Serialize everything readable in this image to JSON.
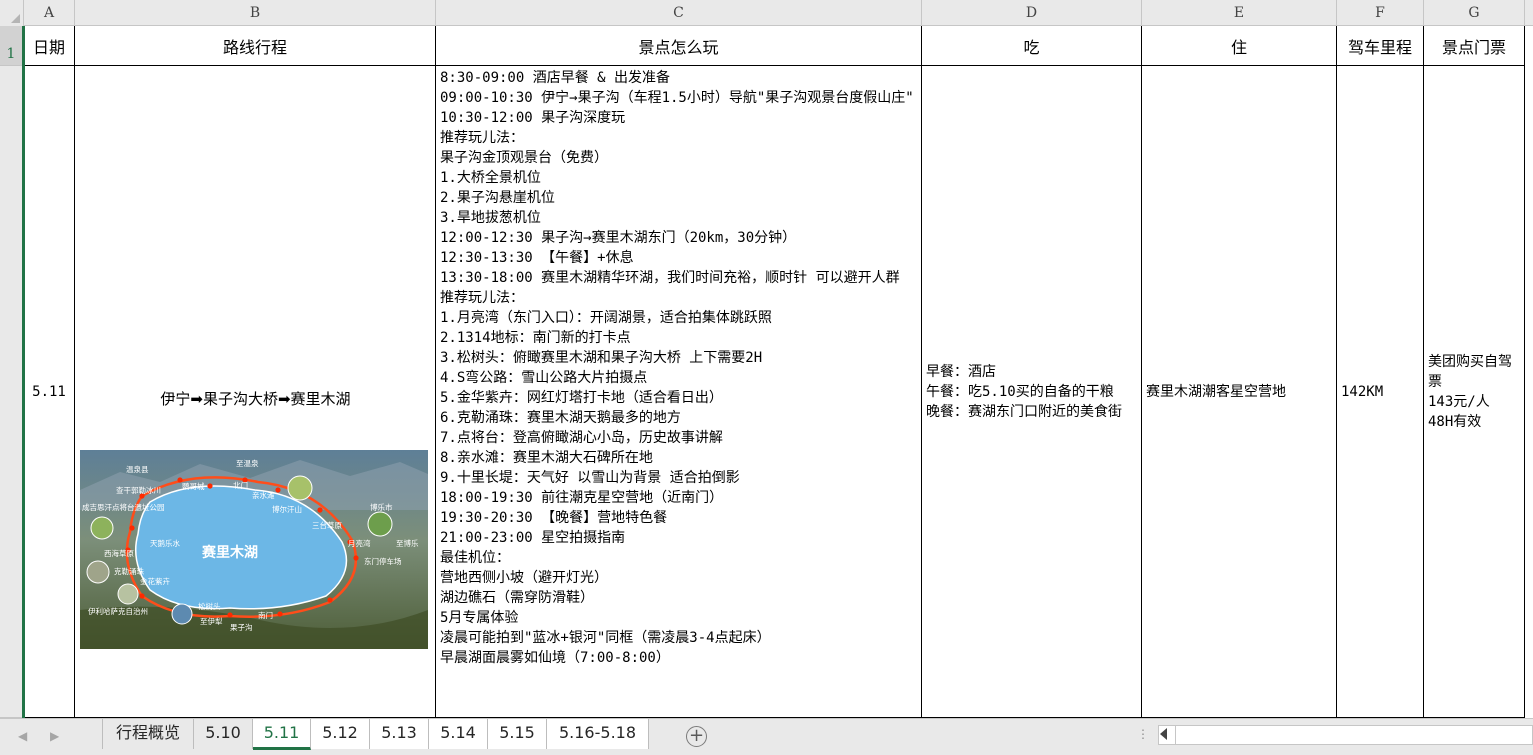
{
  "columns": [
    {
      "letter": "A"
    },
    {
      "letter": "B"
    },
    {
      "letter": "C"
    },
    {
      "letter": "D"
    },
    {
      "letter": "E"
    },
    {
      "letter": "F"
    },
    {
      "letter": "G"
    }
  ],
  "rows": [
    "1",
    ""
  ],
  "header": {
    "date": "日期",
    "route": "路线行程",
    "how_to_play": "景点怎么玩",
    "eat": "吃",
    "stay": "住",
    "driving_distance": "驾车里程",
    "ticket": "景点门票"
  },
  "day": {
    "date": "5.11",
    "route": "伊宁➡果子沟大桥➡赛里木湖",
    "plan_lines": [
      "8:30-09:00 酒店早餐 & 出发准备",
      "09:00-10:30 伊宁→果子沟（车程1.5小时）导航\"果子沟观景台度假山庄\"",
      "10:30-12:00 果子沟深度玩",
      "推荐玩儿法：",
      "果子沟金顶观景台（免费）",
      "1.大桥全景机位",
      "2.果子沟悬崖机位",
      "3.旱地拔葱机位",
      "12:00-12:30 果子沟→赛里木湖东门（20km，30分钟）",
      "12:30-13:30 【午餐】+休息",
      "13:30-18:00 赛里木湖精华环湖，我们时间充裕，顺时针 可以避开人群",
      "推荐玩儿法：",
      "1.月亮湾（东门入口）：开阔湖景，适合拍集体跳跃照",
      "2.1314地标：南门新的打卡点",
      "3.松树头：俯瞰赛里木湖和果子沟大桥 上下需要2H",
      "4.S弯公路：雪山公路大片拍摄点",
      "5.金华紫卉：网红灯塔打卡地（适合看日出）",
      "6.克勒涌珠：赛里木湖天鹅最多的地方",
      "7.点将台：登高俯瞰湖心小岛，历史故事讲解",
      "8.亲水滩：赛里木湖大石碑所在地",
      "9.十里长堤：天气好 以雪山为背景 适合拍倒影",
      "18:00-19:30 前往潮克星空营地（近南门）",
      "19:30-20:30 【晚餐】营地特色餐",
      "21:00-23:00 星空拍摄指南",
      "最佳机位：",
      "营地西侧小坡（避开灯光）",
      "湖边礁石（需穿防滑鞋）",
      "5月专属体验",
      "凌晨可能拍到\"蓝冰+银河\"同框（需凌晨3-4点起床）",
      "早晨湖面晨雾如仙境（7:00-8:00）"
    ],
    "eat_lines": [
      "早餐：酒店",
      "午餐：吃5.10买的自备的干粮",
      "晚餐：赛湖东门口附近的美食街"
    ],
    "stay": "赛里木湖潮客星空营地",
    "distance": "142KM",
    "ticket_lines": [
      "美团购买自驾票",
      "143元/人",
      "48H有效"
    ]
  },
  "map": {
    "lake_name": "赛里木湖",
    "labels": [
      "温泉县",
      "至温泉",
      "查干郭勒冰川",
      "鹦哥城",
      "北门",
      "亲水滩",
      "博尔汗山",
      "博乐市",
      "成吉思汗点将台遗址公园",
      "三台草原",
      "天鹅乐水",
      "月亮湾",
      "至博乐",
      "西海草原",
      "东门停车场",
      "克勒涌珠",
      "金花紫卉",
      "伊利哈萨克自治州",
      "松树头",
      "至伊犁",
      "南门",
      "果子沟"
    ]
  },
  "sheet_tabs": [
    "行程概览",
    "5.10",
    "5.11",
    "5.12",
    "5.13",
    "5.14",
    "5.15",
    "5.16-5.18"
  ],
  "active_tab": "5.11",
  "icons": {
    "tab_prev": "tab-scroll-left-icon",
    "tab_next": "tab-scroll-right-icon",
    "add_sheet": "add-sheet-icon",
    "scroll_left": "scroll-left-icon"
  },
  "colors": {
    "accent": "#217346",
    "header_bg": "#e9e9e9",
    "route_line": "#ff4d1a",
    "lake": "#6cb7e6"
  }
}
